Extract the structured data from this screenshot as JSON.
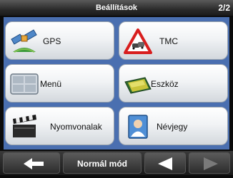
{
  "header": {
    "title": "Beállítások",
    "page_indicator": "2/2"
  },
  "buttons": {
    "gps": {
      "label": "GPS",
      "icon": "satellite-icon"
    },
    "tmc": {
      "label": "TMC",
      "icon": "traffic-warning-icon"
    },
    "menu": {
      "label": "Menü",
      "icon": "menu-grid-icon"
    },
    "device": {
      "label": "Eszköz",
      "icon": "device-screen-icon"
    },
    "tracklogs": {
      "label": "Nyomvonalak",
      "icon": "clapperboard-icon"
    },
    "contact": {
      "label": "Névjegy",
      "icon": "person-card-icon"
    }
  },
  "bottom_bar": {
    "mode_label": "Normál mód",
    "back_icon": "back-arrow-icon",
    "prev_icon": "prev-page-icon",
    "next_icon": "next-page-icon"
  },
  "colors": {
    "panel": "#4a6fb0",
    "background": "#0b0b0b",
    "accent_red": "#d81e1e"
  }
}
